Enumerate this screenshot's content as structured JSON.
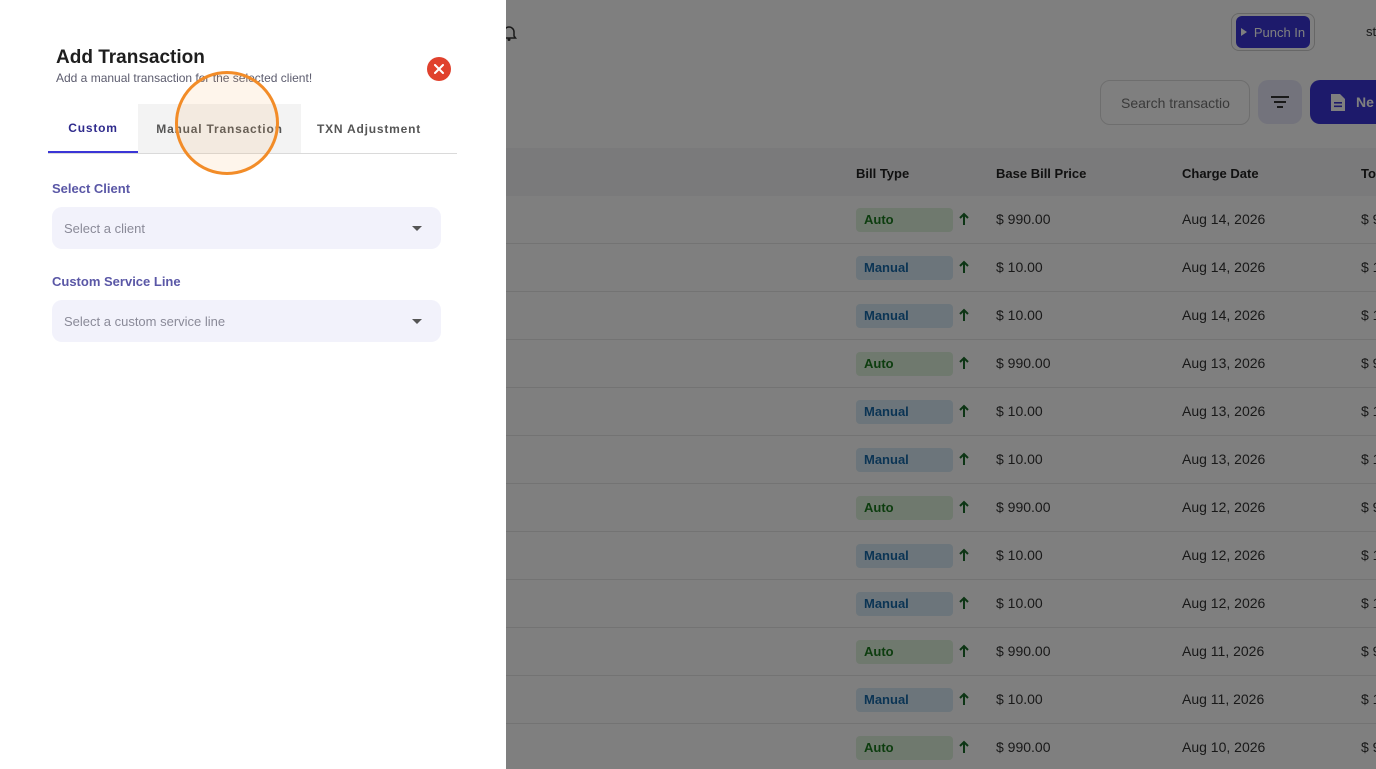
{
  "topbar": {
    "punch_in_label": "Punch In",
    "trailing_text": "st"
  },
  "toolbar": {
    "search_placeholder": "Search transactio",
    "new_button_label": "Ne"
  },
  "table": {
    "columns": [
      "Bill Type",
      "Base Bill Price",
      "Charge Date",
      "Tot"
    ],
    "rows": [
      {
        "bill_type": "Auto",
        "base_price": "$ 990.00",
        "charge_date": "Aug 14, 2026",
        "total": "$ 9"
      },
      {
        "bill_type": "Manual",
        "base_price": "$ 10.00",
        "charge_date": "Aug 14, 2026",
        "total": "$ 1"
      },
      {
        "bill_type": "Manual",
        "base_price": "$ 10.00",
        "charge_date": "Aug 14, 2026",
        "total": "$ 1"
      },
      {
        "bill_type": "Auto",
        "base_price": "$ 990.00",
        "charge_date": "Aug 13, 2026",
        "total": "$ 9"
      },
      {
        "bill_type": "Manual",
        "base_price": "$ 10.00",
        "charge_date": "Aug 13, 2026",
        "total": "$ 1"
      },
      {
        "bill_type": "Manual",
        "base_price": "$ 10.00",
        "charge_date": "Aug 13, 2026",
        "total": "$ 1"
      },
      {
        "bill_type": "Auto",
        "base_price": "$ 990.00",
        "charge_date": "Aug 12, 2026",
        "total": "$ 9"
      },
      {
        "bill_type": "Manual",
        "base_price": "$ 10.00",
        "charge_date": "Aug 12, 2026",
        "total": "$ 1"
      },
      {
        "bill_type": "Manual",
        "base_price": "$ 10.00",
        "charge_date": "Aug 12, 2026",
        "total": "$ 1"
      },
      {
        "bill_type": "Auto",
        "base_price": "$ 990.00",
        "charge_date": "Aug 11, 2026",
        "total": "$ 9"
      },
      {
        "bill_type": "Manual",
        "base_price": "$ 10.00",
        "charge_date": "Aug 11, 2026",
        "total": "$ 1"
      },
      {
        "bill_type": "Auto",
        "base_price": "$ 990.00",
        "charge_date": "Aug 10, 2026",
        "total": "$ 9"
      }
    ]
  },
  "drawer": {
    "title": "Add Transaction",
    "subtitle": "Add a manual transaction for the selected client!",
    "tabs": [
      {
        "label": "Custom",
        "active": true
      },
      {
        "label": "Manual Transaction",
        "active": false
      },
      {
        "label": "TXN Adjustment",
        "active": false
      }
    ],
    "client_label": "Select Client",
    "client_placeholder": "Select a client",
    "service_line_label": "Custom Service Line",
    "service_line_placeholder": "Select a custom service line"
  },
  "colors": {
    "accent": "#3a35d6",
    "close": "#e0412d",
    "auto_badge": "#dff3dd",
    "manual_badge": "#d8ebf7",
    "cursor_highlight": "#f28c28"
  },
  "icons": {
    "topbar": "notification-icon",
    "filter": "filter-icon",
    "new": "document-icon",
    "close": "close-icon",
    "sort": "arrow-up-icon",
    "dropdown": "caret-down-icon"
  }
}
